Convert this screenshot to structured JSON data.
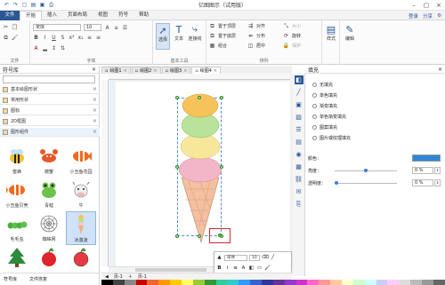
{
  "app": {
    "title": "亿图图示（试用版）"
  },
  "tabs": [
    {
      "label": "文件"
    },
    {
      "label": "开始"
    },
    {
      "label": "插入"
    },
    {
      "label": "页面布局"
    },
    {
      "label": "视图"
    },
    {
      "label": "符号"
    },
    {
      "label": "帮助"
    }
  ],
  "tab_right": {
    "login": "登录",
    "share": "分享"
  },
  "ribbon": {
    "font_name": "宋体",
    "font_size": "10",
    "group_file": "文件",
    "group_font": "字体",
    "group_basic": "基本工具",
    "group_arrange": "排列",
    "select_label": "选择",
    "text_label": "文本",
    "connector_label": "连接线",
    "bring_front": "置于顶层",
    "send_back": "置于底层",
    "group_btn": "组合",
    "align_btn": "对齐",
    "distribute_btn": "分布",
    "center_btn": "居中",
    "size_btn": "大小",
    "rotate_btn": "旋转",
    "protect_btn": "保护",
    "style_label": "样式",
    "edit_label": "编辑"
  },
  "left_panel": {
    "title": "符号库",
    "categories": [
      {
        "label": "基本绘图形状"
      },
      {
        "label": "常用形状"
      },
      {
        "label": "图标"
      },
      {
        "label": "2D框图"
      },
      {
        "label": "图形组件"
      }
    ],
    "shapes": [
      {
        "label": "蜜蜂"
      },
      {
        "label": "螃蟹"
      },
      {
        "label": "小丑鱼花园"
      },
      {
        "label": "小丑鱼贝壳"
      },
      {
        "label": "青蛙"
      },
      {
        "label": "牛"
      },
      {
        "label": "毛毛虫"
      },
      {
        "label": "蜘蛛网"
      },
      {
        "label": "冰激凌"
      },
      {
        "label": "圣诞树"
      },
      {
        "label": "苹果"
      },
      {
        "label": "苹果"
      }
    ],
    "footer": {
      "library": "符号库",
      "restore": "文件恢复"
    }
  },
  "doc_tabs": [
    {
      "label": "绘图1"
    },
    {
      "label": "绘图2"
    },
    {
      "label": "绘图3"
    },
    {
      "label": "绘图4"
    }
  ],
  "page_tabs": {
    "left": "页-1",
    "right": "页-1"
  },
  "float_toolbar": {
    "font": "宋体",
    "size": "10"
  },
  "right_panel": {
    "title": "填充",
    "options": [
      {
        "label": "无填充"
      },
      {
        "label": "单色填充"
      },
      {
        "label": "渐变填充"
      },
      {
        "label": "单色渐变填充"
      },
      {
        "label": "图案填充"
      },
      {
        "label": "图片或纹理填充"
      }
    ],
    "color_label": "颜色：",
    "brightness_label": "亮度：",
    "brightness_value": "0 %",
    "transparency_label": "透明度：",
    "transparency_value": "0 %",
    "color": "#2e86d3"
  }
}
